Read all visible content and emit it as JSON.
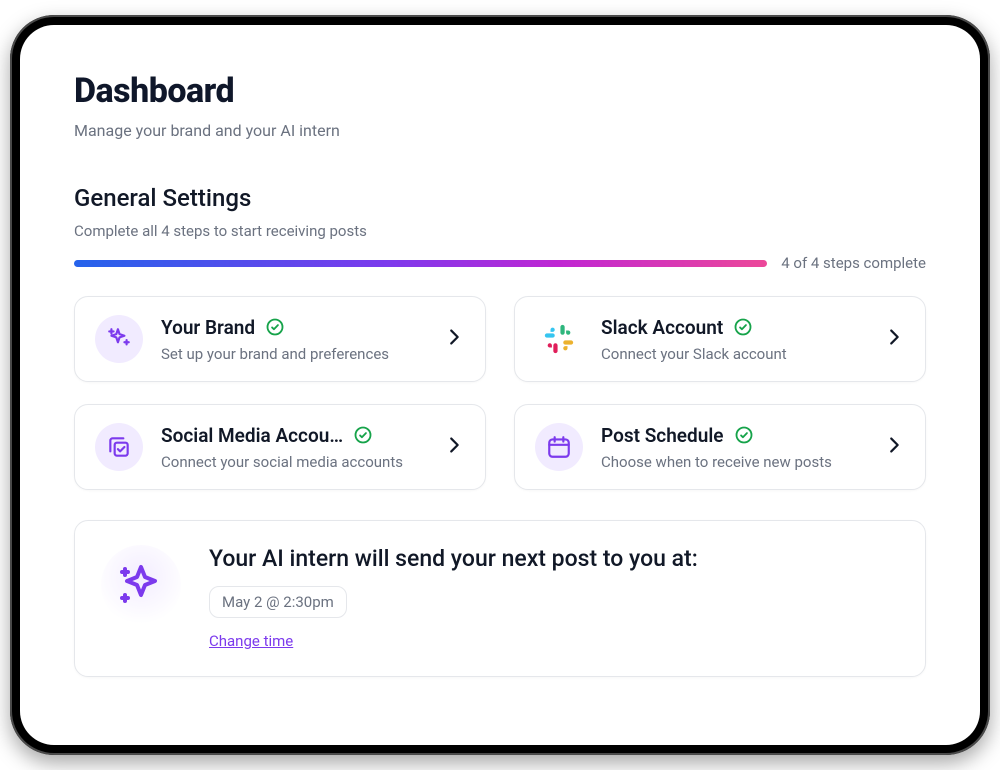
{
  "header": {
    "title": "Dashboard",
    "subtitle": "Manage your brand and your AI intern"
  },
  "section": {
    "title": "General Settings",
    "subtitle": "Complete all 4 steps to start receiving posts",
    "progress_label": "4 of 4 steps complete"
  },
  "cards": {
    "brand": {
      "title": "Your Brand",
      "desc": "Set up your brand and preferences"
    },
    "slack": {
      "title": "Slack Account",
      "desc": "Connect your Slack account"
    },
    "social": {
      "title": "Social Media Accou…",
      "desc": "Connect your social media accounts"
    },
    "schedule": {
      "title": "Post Schedule",
      "desc": "Choose when to receive new posts"
    }
  },
  "next_post": {
    "title": "Your AI intern will send your next post to you at:",
    "time": "May 2 @ 2:30pm",
    "change_label": "Change time"
  },
  "colors": {
    "accent_purple": "#7c3aed",
    "icon_bg": "#f1ebff",
    "check_green": "#16a34a"
  }
}
